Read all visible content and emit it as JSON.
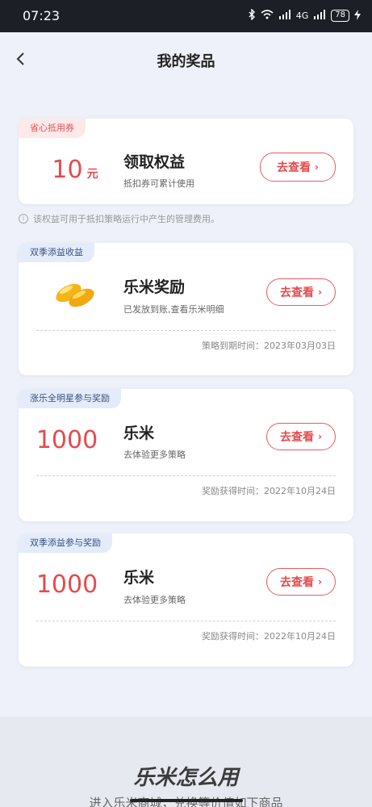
{
  "status": {
    "time": "07:23",
    "network": "4G",
    "battery": "78"
  },
  "header": {
    "title": "我的奖品"
  },
  "cards": [
    {
      "tag": "省心抵用券",
      "amount_number": "10",
      "amount_unit": "元",
      "title": "领取权益",
      "subtitle": "抵扣券可累计使用",
      "button": "去查看"
    },
    {
      "tag": "双季添益收益",
      "title": "乐米奖励",
      "subtitle": "已发放到账,查看乐米明细",
      "button": "去查看",
      "date_line": "策略到期时间：2023年03月03日"
    },
    {
      "tag": "涨乐全明星参与奖励",
      "amount_number": "1000",
      "title": "乐米",
      "subtitle": "去体验更多策略",
      "button": "去查看",
      "date_line": "奖励获得时间：2022年10月24日"
    },
    {
      "tag": "双季添益参与奖励",
      "amount_number": "1000",
      "title": "乐米",
      "subtitle": "去体验更多策略",
      "button": "去查看",
      "date_line": "奖励获得时间：2022年10月24日"
    }
  ],
  "notice": "该权益可用于抵扣策略运行中产生的管理费用。",
  "bottom": {
    "heading": "乐米怎么用",
    "subtitle": "进入乐米商城，兑换等价值如下商品"
  },
  "colors": {
    "accent": "#e34b4f",
    "status_bar": "#1d1f26",
    "page_bg": "#eef1f9"
  }
}
